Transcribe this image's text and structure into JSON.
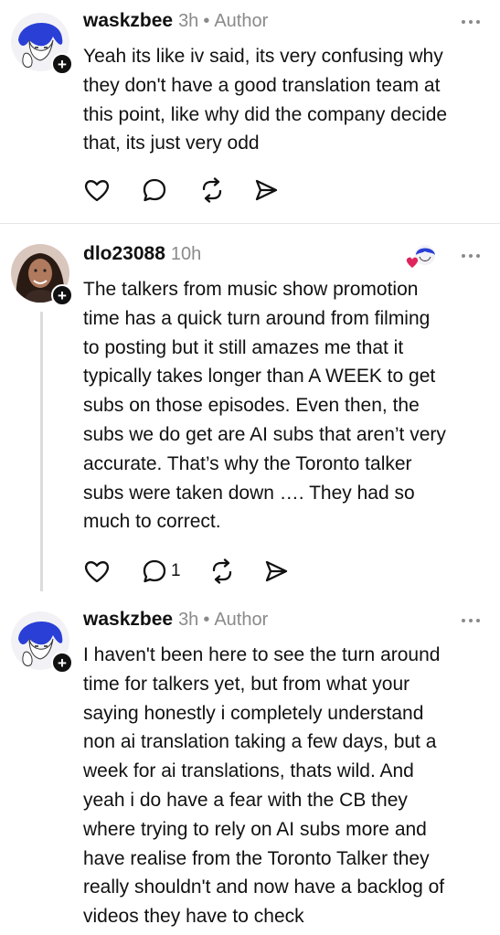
{
  "comments": [
    {
      "username": "waskzbee",
      "time": "3h",
      "author_label": "Author",
      "text": "Yeah its like iv said, its very confusing why\nthey don't have a good translation team at\nthis point, like why did the company decide\nthat, its just very odd",
      "reply_count": ""
    },
    {
      "username": "dlo23088",
      "time": "10h",
      "text": "The talkers from music show promotion\ntime has a quick turn around from filming\nto posting but it still amazes me that it\ntypically takes longer than A WEEK to get\nsubs on those episodes. Even then, the\nsubs we do get are AI subs that aren’t very\naccurate. That’s why the Toronto talker\nsubs were taken down …. They had so\nmuch to correct.",
      "reply_count": "1"
    },
    {
      "username": "waskzbee",
      "time": "3h",
      "author_label": "Author",
      "text": "I haven't been here to see the turn around\ntime for talkers yet, but from what your\nsaying honestly i completely understand\nnon ai translation taking a few days, but a\nweek for ai translations, thats wild. And\nyeah i do have a fear with the CB they\nwhere trying to rely on AI subs more and\nhave realise from the Toronto Talker they\nreally shouldn't and now have a backlog of\nvideos they have to check"
    }
  ],
  "separator": "•",
  "colors": {
    "text": "#111111",
    "muted": "#8a8a8a",
    "divider": "#e6e6e6",
    "avatar_blue": "#2a3fd6",
    "like_red": "#e0245e"
  },
  "icons": {
    "like": "heart-icon",
    "reply": "comment-icon",
    "repost": "repost-icon",
    "share": "send-icon",
    "more": "more-dots-icon",
    "plus": "plus-icon"
  }
}
